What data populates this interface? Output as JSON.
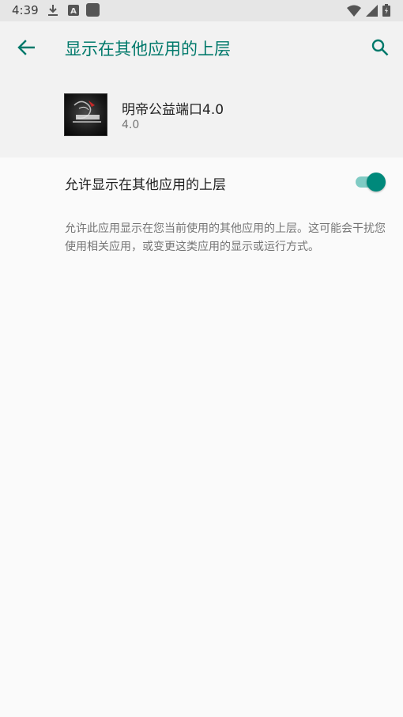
{
  "status_bar": {
    "time": "4:39",
    "icons": [
      "download-icon",
      "a-notification-icon",
      "square-notification-icon",
      "wifi-icon",
      "signal-icon",
      "battery-icon"
    ]
  },
  "toolbar": {
    "title": "显示在其他应用的上层",
    "accent_color": "#00796b"
  },
  "app": {
    "name": "明帝公益端口4.0",
    "version": "4.0"
  },
  "setting": {
    "label": "允许显示在其他应用的上层",
    "enabled": true
  },
  "description": "允许此应用显示在您当前使用的其他应用的上层。这可能会干扰您使用相关应用，或变更这类应用的显示或运行方式。"
}
